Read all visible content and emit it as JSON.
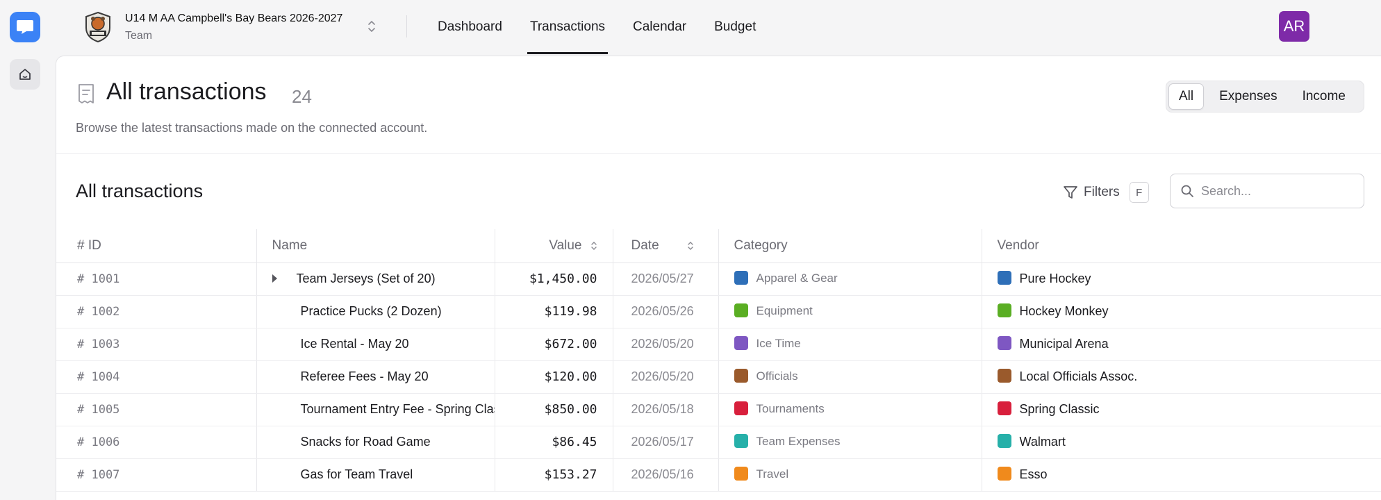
{
  "nav": {
    "team_name": "U14 M AA Campbell's Bay Bears 2026-2027",
    "team_subtitle": "Team",
    "tabs": [
      {
        "label": "Dashboard"
      },
      {
        "label": "Transactions",
        "active": true
      },
      {
        "label": "Calendar"
      },
      {
        "label": "Budget"
      }
    ],
    "avatar_initials": "AR"
  },
  "page": {
    "title": "All transactions",
    "count": "24",
    "description": "Browse the latest transactions made on the connected account.",
    "segments": [
      "All",
      "Expenses",
      "Income"
    ],
    "active_segment": "All"
  },
  "table_section": {
    "title": "All transactions",
    "filters_label": "Filters",
    "filters_shortcut": "F",
    "search_placeholder": "Search...",
    "columns": [
      "# ID",
      "Name",
      "Value",
      "Date",
      "Category",
      "Vendor"
    ],
    "rows": [
      {
        "id": "# 1001",
        "name": "Team Jerseys (Set of 20)",
        "expandable": true,
        "value": "$1,450.00",
        "date": "2026/05/27",
        "category": "Apparel & Gear",
        "color": "#2e6fb8",
        "vendor": "Pure Hockey"
      },
      {
        "id": "# 1002",
        "name": "Practice Pucks (2 Dozen)",
        "expandable": false,
        "value": "$119.98",
        "date": "2026/05/26",
        "category": "Equipment",
        "color": "#5aae23",
        "vendor": "Hockey Monkey"
      },
      {
        "id": "# 1003",
        "name": "Ice Rental - May 20",
        "expandable": false,
        "value": "$672.00",
        "date": "2026/05/20",
        "category": "Ice Time",
        "color": "#7e57c2",
        "vendor": "Municipal Arena"
      },
      {
        "id": "# 1004",
        "name": "Referee Fees - May 20",
        "expandable": false,
        "value": "$120.00",
        "date": "2026/05/20",
        "category": "Officials",
        "color": "#9a5a2c",
        "vendor": "Local Officials Assoc."
      },
      {
        "id": "# 1005",
        "name": "Tournament Entry Fee - Spring Classic",
        "expandable": false,
        "value": "$850.00",
        "date": "2026/05/18",
        "category": "Tournaments",
        "color": "#d81f3c",
        "vendor": "Spring Classic"
      },
      {
        "id": "# 1006",
        "name": "Snacks for Road Game",
        "expandable": false,
        "value": "$86.45",
        "date": "2026/05/17",
        "category": "Team Expenses",
        "color": "#26b0a9",
        "vendor": "Walmart"
      },
      {
        "id": "# 1007",
        "name": "Gas for Team Travel",
        "expandable": false,
        "value": "$153.27",
        "date": "2026/05/16",
        "category": "Travel",
        "color": "#f08a1c",
        "vendor": "Esso"
      }
    ]
  }
}
